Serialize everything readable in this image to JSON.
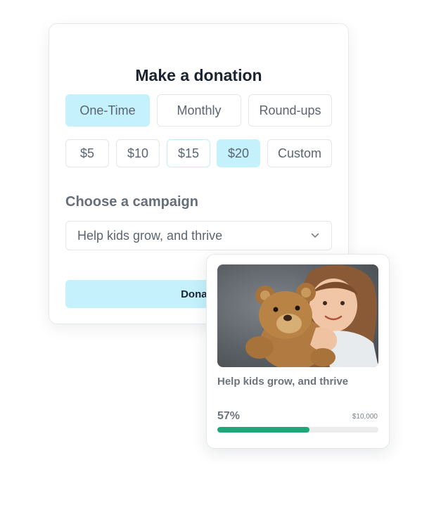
{
  "donation": {
    "title": "Make a donation",
    "frequency": [
      {
        "label": "One-Time",
        "selected": true
      },
      {
        "label": "Monthly",
        "selected": false
      },
      {
        "label": "Round-ups",
        "selected": false
      }
    ],
    "amounts": [
      {
        "label": "$5",
        "selected": false
      },
      {
        "label": "$10",
        "selected": false
      },
      {
        "label": "$15",
        "selected": false
      },
      {
        "label": "$20",
        "selected": true
      },
      {
        "label": "Custom",
        "selected": false
      }
    ],
    "campaign_label": "Choose a campaign",
    "campaign_select": "Help kids grow, and thrive",
    "donate_label": "Donate"
  },
  "campaign_card": {
    "title": "Help kids grow, and thrive",
    "percent": "57%",
    "goal": "$10,000",
    "progress": 0.57,
    "accent": "#1ea779"
  },
  "colors": {
    "selected": "#c4f1fb",
    "heading": "#1a2430",
    "text": "#5b6570"
  }
}
